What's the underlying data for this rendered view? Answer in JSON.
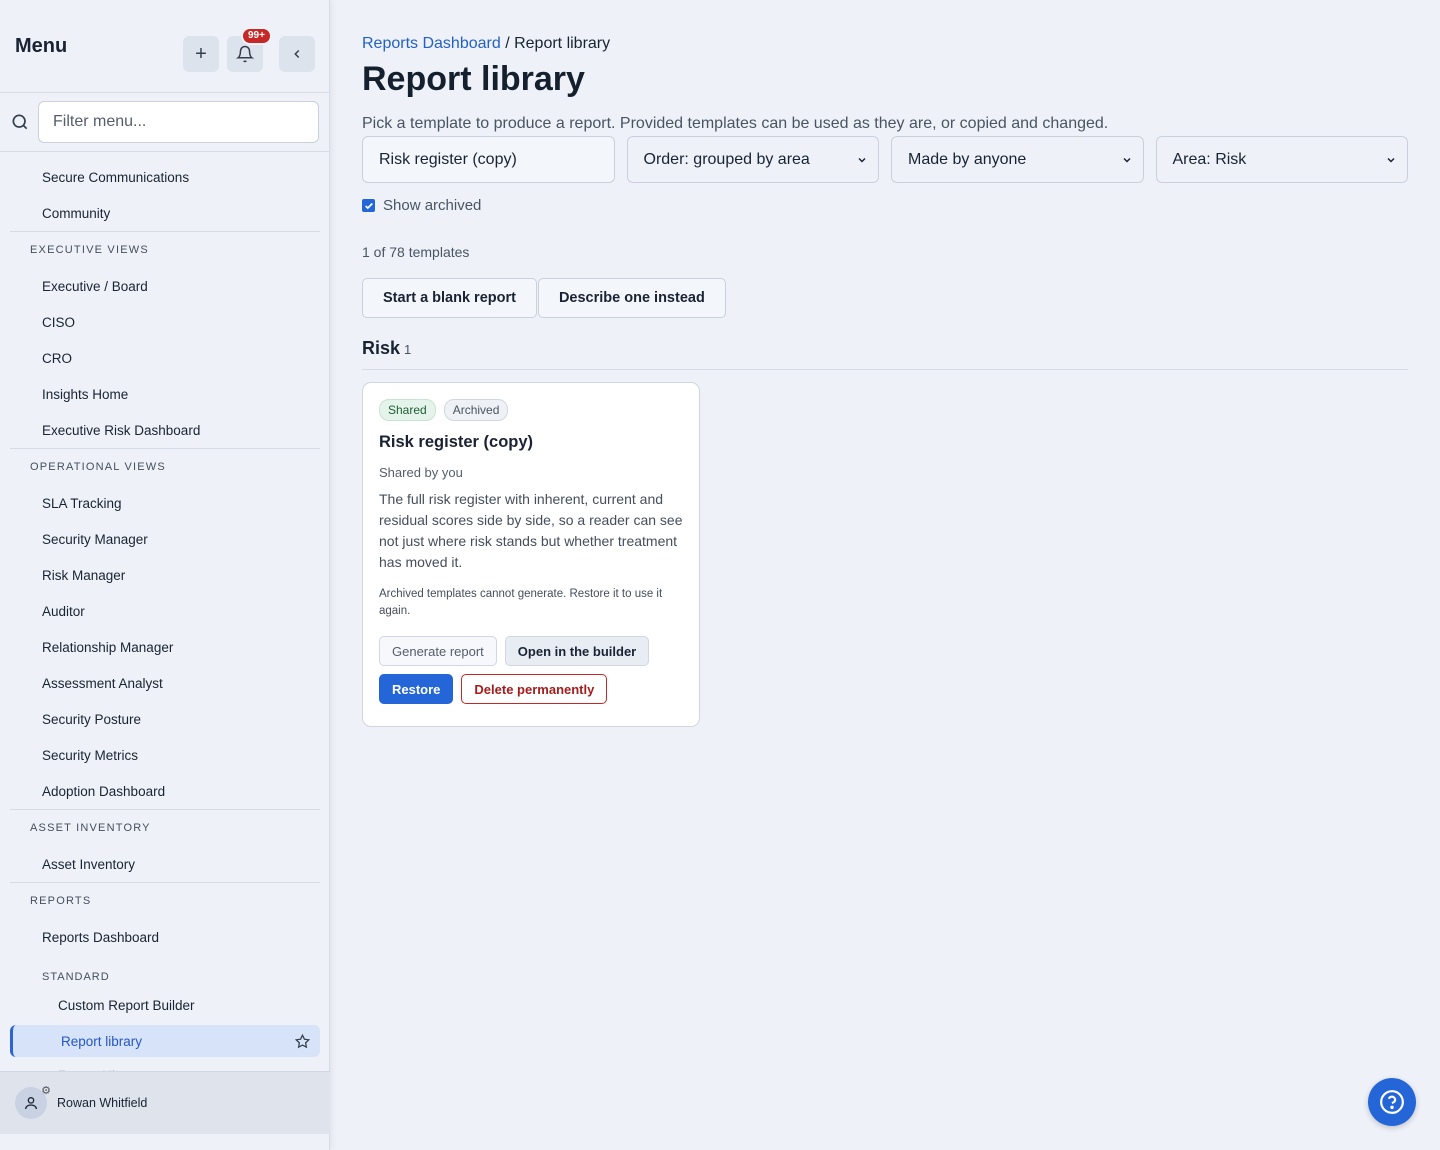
{
  "sidebar": {
    "title": "Menu",
    "notification_count": "99+",
    "filter_placeholder": "Filter menu...",
    "items_top": [
      "Secure Communications",
      "Community"
    ],
    "executive": {
      "heading": "EXECUTIVE VIEWS",
      "items": [
        "Executive / Board",
        "CISO",
        "CRO",
        "Insights Home",
        "Executive Risk Dashboard"
      ]
    },
    "operational": {
      "heading": "OPERATIONAL VIEWS",
      "items": [
        "SLA Tracking",
        "Security Manager",
        "Risk Manager",
        "Auditor",
        "Relationship Manager",
        "Assessment Analyst",
        "Security Posture",
        "Security Metrics",
        "Adoption Dashboard"
      ]
    },
    "assets": {
      "heading": "ASSET INVENTORY",
      "items": [
        "Asset Inventory"
      ]
    },
    "reports": {
      "heading": "REPORTS",
      "dashboard": "Reports Dashboard",
      "standard_heading": "STANDARD",
      "builder": "Custom Report Builder",
      "library": "Report library",
      "history": "Report History"
    },
    "user": "Rowan Whitfield"
  },
  "breadcrumb": {
    "parent": "Reports Dashboard",
    "separator": " / ",
    "current": "Report library"
  },
  "page": {
    "title": "Report library",
    "subtitle": "Pick a template to produce a report. Provided templates can be used as they are, or copied and changed."
  },
  "filters": {
    "search_value": "Risk register (copy)",
    "order": "Order: grouped by area",
    "maker": "Made by anyone",
    "area": "Area: Risk"
  },
  "show_archived": {
    "label": "Show archived",
    "checked": true
  },
  "count_text": "1 of 78 templates",
  "actions": {
    "blank": "Start a blank report",
    "describe": "Describe one instead"
  },
  "group": {
    "name": "Risk",
    "count": "1"
  },
  "card": {
    "tags": {
      "shared": "Shared",
      "archived": "Archived"
    },
    "title": "Risk register (copy)",
    "by": "Shared by you",
    "description": "The full risk register with inherent, current and residual scores side by side, so a reader can see not just where risk stands but whether treatment has moved it.",
    "note": "Archived templates cannot generate. Restore it to use it again.",
    "buttons": {
      "generate": "Generate report",
      "open": "Open in the builder",
      "restore": "Restore",
      "delete": "Delete permanently"
    }
  },
  "colors": {
    "accent": "#2466d8",
    "danger": "#c62828"
  }
}
